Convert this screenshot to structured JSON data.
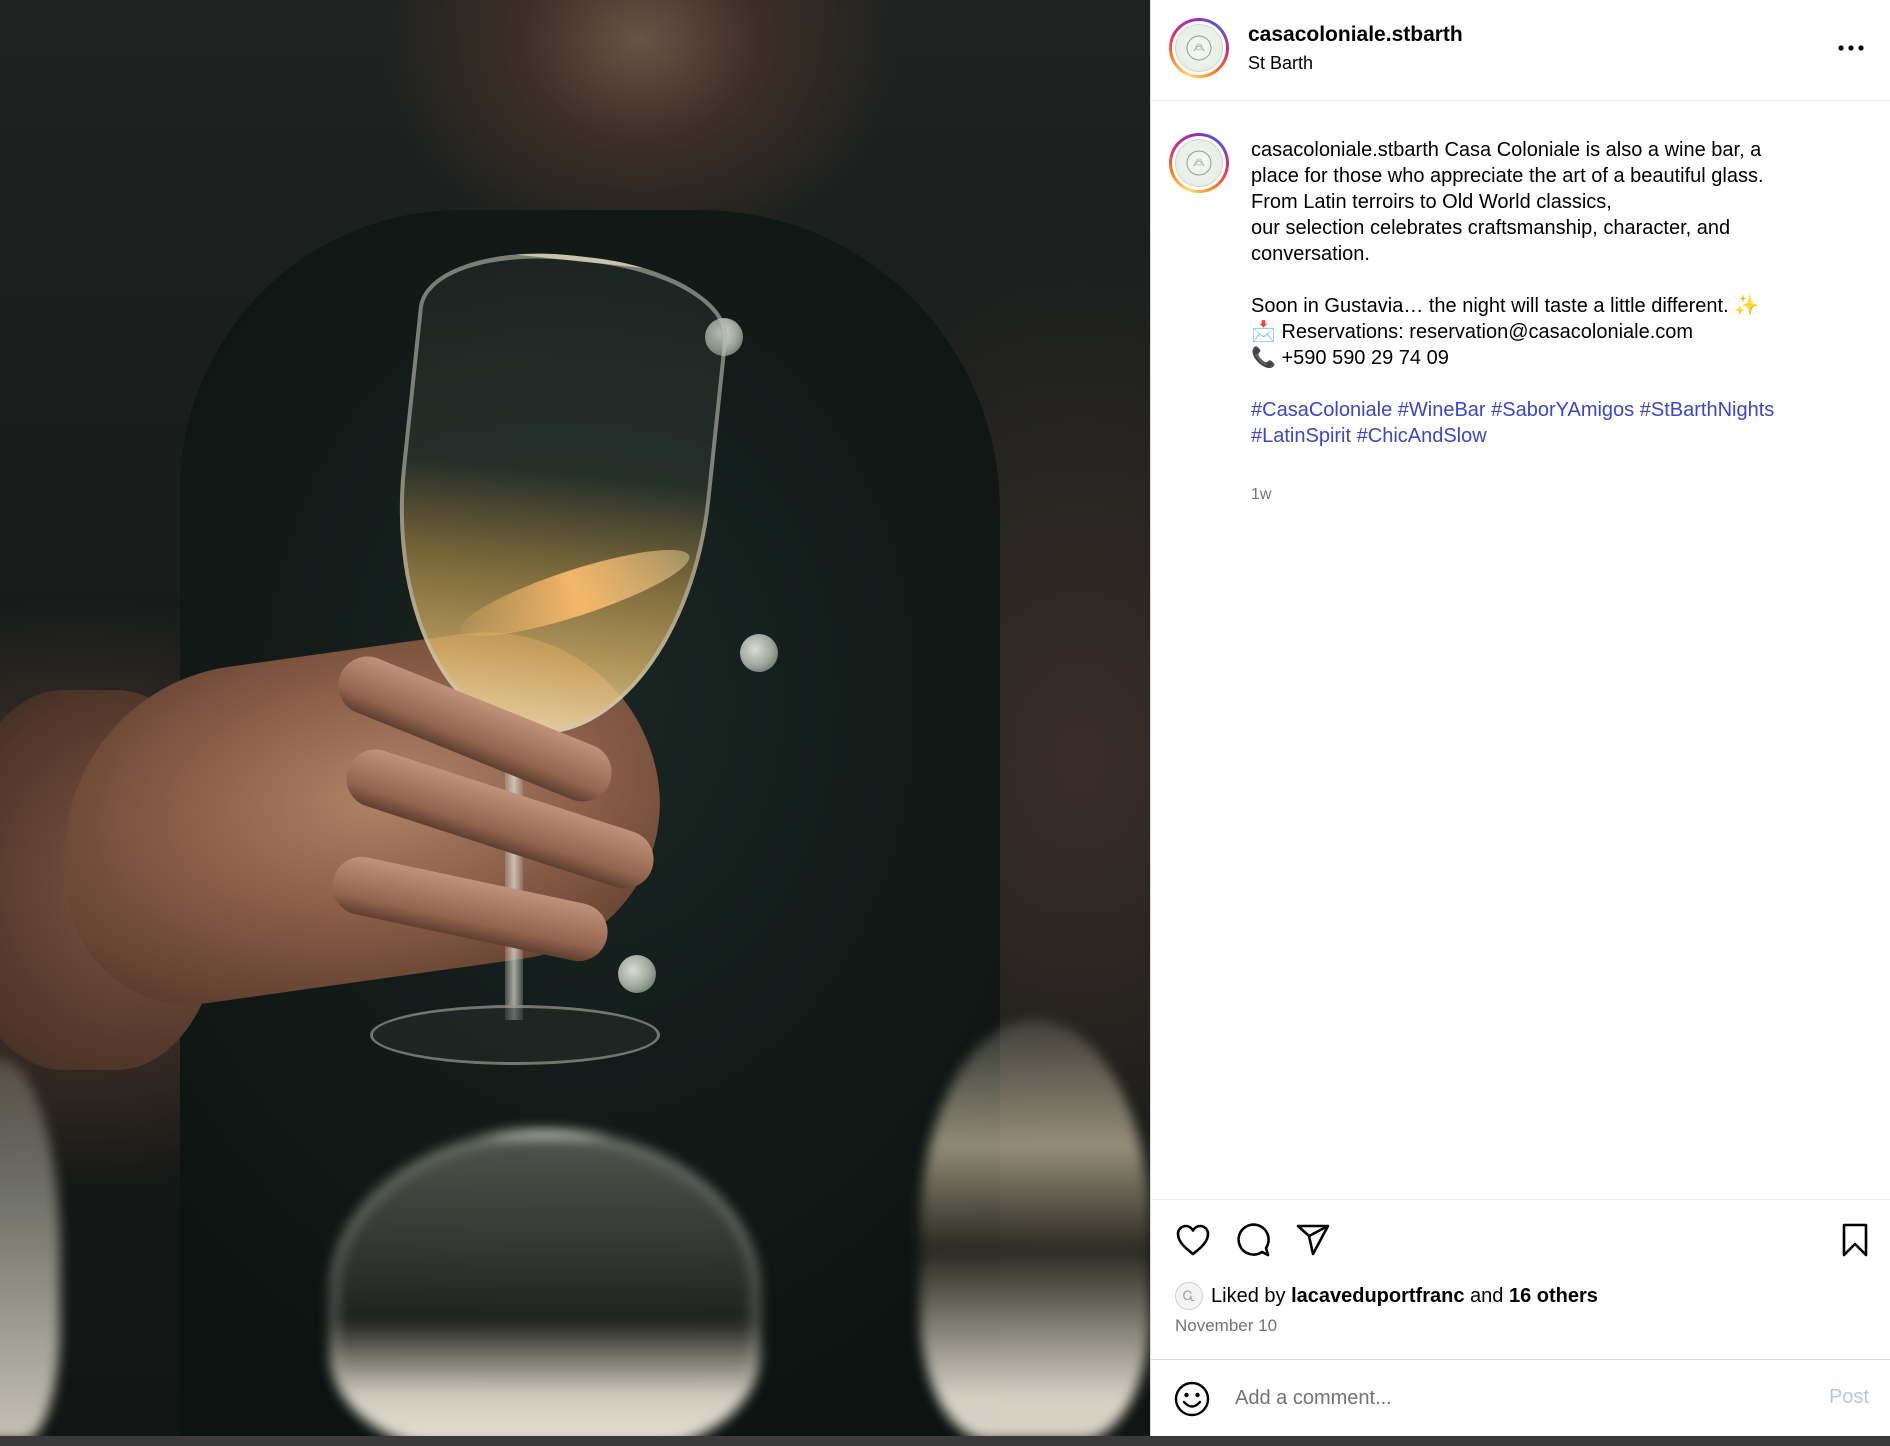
{
  "post": {
    "username": "casacoloniale.stbarth",
    "location": "St Barth",
    "caption": {
      "user": "casacoloniale.stbarth",
      "lines": [
        "Casa Coloniale is also a wine bar, a",
        "place for those who appreciate the art of a beautiful glass.",
        "From Latin terroirs to Old World classics,",
        "our selection celebrates craftsmanship, character, and",
        "conversation."
      ],
      "soon": "Soon in Gustavia… the night will taste a little different. ✨",
      "reservations": "📩 Reservations: reservation@casacoloniale.com",
      "phone": "📞 +590 590 29 74 09",
      "hashtags": [
        "#CasaColoniale",
        "#WineBar",
        "#SaborYAmigos",
        "#StBarthNights",
        "#LatinSpirit",
        "#ChicAndSlow"
      ]
    },
    "time_ago": "1w",
    "likes": {
      "prefix": "Liked by",
      "user": "lacaveduportfranc",
      "conjunction": "and",
      "others": "16 others"
    },
    "date": "November 10"
  },
  "comment": {
    "placeholder": "Add a comment...",
    "post_label": "Post"
  },
  "icons": {
    "more": "more-horizontal-icon",
    "like": "heart-icon",
    "comment": "comment-bubble-icon",
    "share": "paper-plane-icon",
    "save": "bookmark-icon",
    "emoji": "smiley-icon"
  },
  "colors": {
    "hashtag": "#3b46c9",
    "post_disabled": "#b2c8f5",
    "muted": "#737373"
  }
}
